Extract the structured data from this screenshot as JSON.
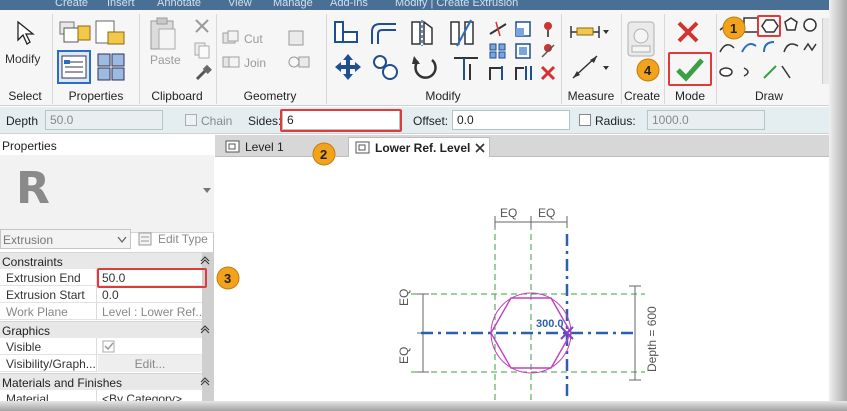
{
  "ribbon": {
    "tabs": [
      "Create",
      "Insert",
      "Annotate",
      "View",
      "Manage",
      "Add-Ins",
      "Modify | Create Extrusion"
    ],
    "panels": {
      "select": "Select",
      "properties": "Properties",
      "clipboard": "Clipboard",
      "geometry": "Geometry",
      "modify": "Modify",
      "measure": "Measure",
      "create": "Create",
      "mode": "Mode",
      "draw": "Draw"
    },
    "tools": {
      "modify": "Modify",
      "paste": "Paste",
      "cut": "Cut",
      "join": "Join"
    }
  },
  "options_bar": {
    "depth_label": "Depth",
    "depth_value": "50.0",
    "chain_label": "Chain",
    "sides_label": "Sides:",
    "sides_value": "6",
    "offset_label": "Offset:",
    "offset_value": "0.0",
    "radius_label": "Radius:",
    "radius_value": "1000.0"
  },
  "properties": {
    "title": "Properties",
    "type_value": "Extrusion",
    "edit_type": "Edit Type",
    "sections": {
      "constraints": "Constraints",
      "graphics": "Graphics",
      "materials": "Materials and Finishes"
    },
    "rows": {
      "extrusion_end": {
        "k": "Extrusion End",
        "v": "50.0"
      },
      "extrusion_start": {
        "k": "Extrusion Start",
        "v": "0.0"
      },
      "work_plane": {
        "k": "Work Plane",
        "v": "Level : Lower Ref..."
      },
      "visible": {
        "k": "Visible"
      },
      "visibility": {
        "k": "Visibility/Graph...",
        "v": "Edit..."
      },
      "material": {
        "k": "Material",
        "v": "<By Category>"
      }
    }
  },
  "view_tabs": [
    {
      "label": "Level 1"
    },
    {
      "label": "Lower Ref. Level"
    }
  ],
  "canvas": {
    "eq_top_left": "EQ",
    "eq_top_right": "EQ",
    "eq_left_top": "EQ",
    "eq_left_bottom": "EQ",
    "radius_dim": "300.0",
    "depth_dim": "Depth = 600"
  },
  "callouts": [
    "1",
    "2",
    "3",
    "4"
  ],
  "colors": {
    "callout_red": "#e03a3a",
    "badge_orange": "#f3a21b",
    "mode_finish_green": "#3aa043",
    "mode_cancel_red": "#d63030",
    "ref_plane_blue": "#2d5fb0",
    "sketch_magenta": "#c040c0"
  }
}
